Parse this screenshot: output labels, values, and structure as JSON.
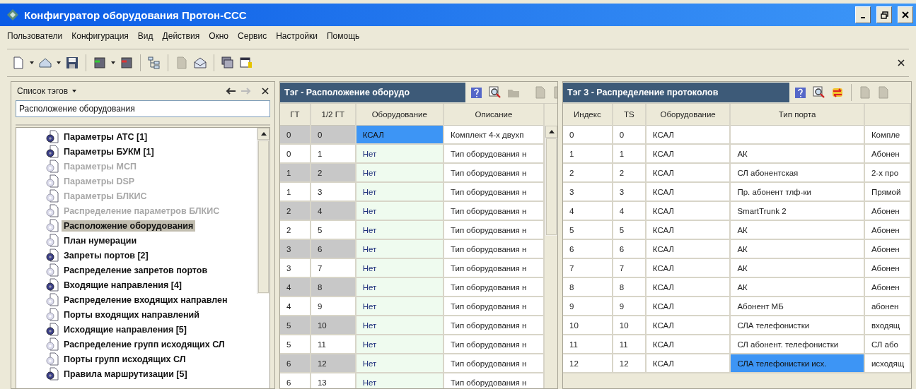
{
  "window": {
    "title": "Конфигуратор оборудования Протон-ССС"
  },
  "menu": [
    "Пользователи",
    "Конфигурация",
    "Вид",
    "Действия",
    "Окно",
    "Сервис",
    "Настройки",
    "Помощь"
  ],
  "tag_panel": {
    "title": "Список тэгов",
    "search": {
      "value": "Расположение оборудования"
    },
    "items": [
      {
        "label": "Параметры АТС [1]",
        "populated": true,
        "disabled": false,
        "selected": false
      },
      {
        "label": "Параметры БУКМ [1]",
        "populated": true,
        "disabled": false,
        "selected": false
      },
      {
        "label": "Параметры МСП",
        "populated": false,
        "disabled": true,
        "selected": false
      },
      {
        "label": "Параметры DSP",
        "populated": false,
        "disabled": true,
        "selected": false
      },
      {
        "label": "Параметры БЛКИС",
        "populated": false,
        "disabled": true,
        "selected": false
      },
      {
        "label": "Распределение параметров БЛКИС",
        "populated": false,
        "disabled": true,
        "selected": false
      },
      {
        "label": "Расположение оборудования",
        "populated": false,
        "disabled": false,
        "selected": true
      },
      {
        "label": "План нумерации",
        "populated": false,
        "disabled": false,
        "selected": false
      },
      {
        "label": "Запреты портов [2]",
        "populated": true,
        "disabled": false,
        "selected": false
      },
      {
        "label": "Распределение запретов портов",
        "populated": false,
        "disabled": false,
        "selected": false
      },
      {
        "label": "Входящие направления [4]",
        "populated": true,
        "disabled": false,
        "selected": false
      },
      {
        "label": "Распределение входящих направлен",
        "populated": false,
        "disabled": false,
        "selected": false
      },
      {
        "label": "Порты входящих направлений",
        "populated": false,
        "disabled": false,
        "selected": false
      },
      {
        "label": "Исходящие направления [5]",
        "populated": true,
        "disabled": false,
        "selected": false
      },
      {
        "label": "Распределение групп исходящих СЛ",
        "populated": false,
        "disabled": false,
        "selected": false
      },
      {
        "label": "Порты групп исходящих СЛ",
        "populated": false,
        "disabled": false,
        "selected": false
      },
      {
        "label": "Правила маршрутизации [5]",
        "populated": true,
        "disabled": false,
        "selected": false
      }
    ]
  },
  "equipment_table": {
    "title": "Тэг - Расположение оборудо",
    "columns": [
      {
        "label": "ГТ",
        "kind": "key"
      },
      {
        "label": "1/2 ГТ",
        "kind": "key"
      },
      {
        "label": "Оборудование",
        "kind": "choice"
      },
      {
        "label": "Описание",
        "kind": "text"
      }
    ],
    "rows": [
      {
        "cells": [
          "0",
          "0",
          "КСАЛ",
          "Комплект 4-х двухп"
        ],
        "shaded": true,
        "selected": true
      },
      {
        "cells": [
          "0",
          "1",
          "Нет",
          "Тип оборудования н"
        ],
        "shaded": false,
        "selected": false
      },
      {
        "cells": [
          "1",
          "2",
          "Нет",
          "Тип оборудования н"
        ],
        "shaded": true,
        "selected": false
      },
      {
        "cells": [
          "1",
          "3",
          "Нет",
          "Тип оборудования н"
        ],
        "shaded": false,
        "selected": false
      },
      {
        "cells": [
          "2",
          "4",
          "Нет",
          "Тип оборудования н"
        ],
        "shaded": true,
        "selected": false
      },
      {
        "cells": [
          "2",
          "5",
          "Нет",
          "Тип оборудования н"
        ],
        "shaded": false,
        "selected": false
      },
      {
        "cells": [
          "3",
          "6",
          "Нет",
          "Тип оборудования н"
        ],
        "shaded": true,
        "selected": false
      },
      {
        "cells": [
          "3",
          "7",
          "Нет",
          "Тип оборудования н"
        ],
        "shaded": false,
        "selected": false
      },
      {
        "cells": [
          "4",
          "8",
          "Нет",
          "Тип оборудования н"
        ],
        "shaded": true,
        "selected": false
      },
      {
        "cells": [
          "4",
          "9",
          "Нет",
          "Тип оборудования н"
        ],
        "shaded": false,
        "selected": false
      },
      {
        "cells": [
          "5",
          "10",
          "Нет",
          "Тип оборудования н"
        ],
        "shaded": true,
        "selected": false
      },
      {
        "cells": [
          "5",
          "11",
          "Нет",
          "Тип оборудования н"
        ],
        "shaded": false,
        "selected": false
      },
      {
        "cells": [
          "6",
          "12",
          "Нет",
          "Тип оборудования н"
        ],
        "shaded": true,
        "selected": false
      },
      {
        "cells": [
          "6",
          "13",
          "Нет",
          "Тип оборудования н"
        ],
        "shaded": false,
        "selected": false
      }
    ]
  },
  "protocol_table": {
    "title": "Тэг 3 - Распределение протоколов",
    "columns": [
      {
        "label": "Индекс",
        "kind": "text"
      },
      {
        "label": "TS",
        "kind": "text"
      },
      {
        "label": "Оборудование",
        "kind": "text"
      },
      {
        "label": "Тип порта",
        "kind": "editable"
      },
      {
        "kind": "text"
      }
    ],
    "rows": [
      {
        "cells": [
          "0",
          "0",
          "КСАЛ",
          "",
          "Компле"
        ],
        "selected": false
      },
      {
        "cells": [
          "1",
          "1",
          "КСАЛ",
          "АК",
          "Абонен"
        ],
        "selected": false
      },
      {
        "cells": [
          "2",
          "2",
          "КСАЛ",
          "СЛ абонентская",
          "2-х про"
        ],
        "selected": false
      },
      {
        "cells": [
          "3",
          "3",
          "КСАЛ",
          "Пр. абонент тлф-ки",
          "Прямой"
        ],
        "selected": false
      },
      {
        "cells": [
          "4",
          "4",
          "КСАЛ",
          "SmartTrunk 2",
          "Абонен"
        ],
        "selected": false
      },
      {
        "cells": [
          "5",
          "5",
          "КСАЛ",
          "АК",
          "Абонен"
        ],
        "selected": false
      },
      {
        "cells": [
          "6",
          "6",
          "КСАЛ",
          "АК",
          "Абонен"
        ],
        "selected": false
      },
      {
        "cells": [
          "7",
          "7",
          "КСАЛ",
          "АК",
          "Абонен"
        ],
        "selected": false
      },
      {
        "cells": [
          "8",
          "8",
          "КСАЛ",
          "АК",
          "Абонен"
        ],
        "selected": false
      },
      {
        "cells": [
          "9",
          "9",
          "КСАЛ",
          "Абонент МБ",
          "абонен"
        ],
        "selected": false
      },
      {
        "cells": [
          "10",
          "10",
          "КСАЛ",
          "СЛА телефонистки",
          "входящ"
        ],
        "selected": false
      },
      {
        "cells": [
          "11",
          "11",
          "КСАЛ",
          "СЛ абонент. телефонистки",
          "СЛ або"
        ],
        "selected": false
      },
      {
        "cells": [
          "12",
          "12",
          "КСАЛ",
          "СЛА телефонистки исх.",
          "исходящ"
        ],
        "selected": true
      }
    ]
  }
}
